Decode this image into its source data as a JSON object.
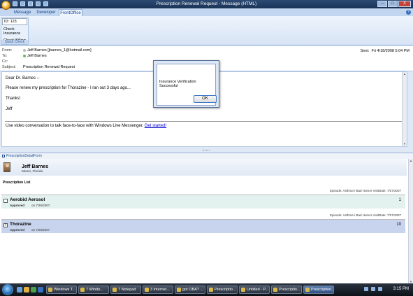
{
  "window": {
    "title": "Prescription Renewal Request - Message (HTML)",
    "controls": [
      "–",
      "□",
      "X"
    ]
  },
  "ribbon": {
    "tabs": [
      "Message",
      "Developer",
      "FrontOffice"
    ],
    "active_tab": "FrontOffice",
    "group": {
      "id_label": "ID:",
      "id_value": "123",
      "buttons": [
        "Check Insurance",
        "Check Billing"
      ],
      "group_label": "Quick Check"
    }
  },
  "header": {
    "from_label": "From:",
    "from_value": "Jeff Barnes [jbarnes_1@hotmail.com]",
    "to_label": "To:",
    "to_value": "Jeff Barnes",
    "cc_label": "Cc:",
    "cc_value": "",
    "subject_label": "Subject:",
    "subject_value": "Prescription Renewal Request",
    "sent_label": "Sent:",
    "sent_value": "Fri 4/18/2008 5:04 PM"
  },
  "message": {
    "greeting": "Dear Dr. Barnes --",
    "line1": "Please renew my prescription for Thorazine - I ran out 3 days ago...",
    "thanks": "Thanks!",
    "signature": "Jeff",
    "footer_text": "Use video conversation to talk face-to-face with Windows Live Messenger.",
    "footer_link": "Get started!"
  },
  "dialog": {
    "message": "Insurance Verification Successful",
    "ok_label": "OK"
  },
  "form": {
    "region_title": "PrescriptionDetailForm",
    "patient": {
      "name": "Jeff Barnes",
      "location": "Miami, Florida"
    },
    "list_title": "Prescription List",
    "prescriptions": [
      {
        "episode": "Episode: Asthma / Bad Humor VisitDate: 7/27/2007",
        "name": "Aerobid Aerosol",
        "status": "Approved",
        "date": "on 7/26/2007",
        "quantity": "1",
        "checked": false,
        "check_mark": "",
        "color": "#e3f1ef"
      },
      {
        "episode": "Episode: Asthma / Bad Humor VisitDate: 7/27/2007",
        "name": "Thorazine",
        "status": "Approved",
        "date": "on 7/26/2007",
        "quantity": "10",
        "checked": true,
        "check_mark": "✓",
        "color": "#c8d4ee"
      }
    ]
  },
  "taskbar": {
    "buttons": [
      "Windows T...",
      "7 Windo...",
      "7 Notepad",
      "3 Internet...",
      "got OBA? ...",
      "Prescriptio...",
      "Untitled - P...",
      "Prescriptio...",
      "Prescription..."
    ],
    "active_index": 8,
    "clock": "3:15 PM"
  }
}
